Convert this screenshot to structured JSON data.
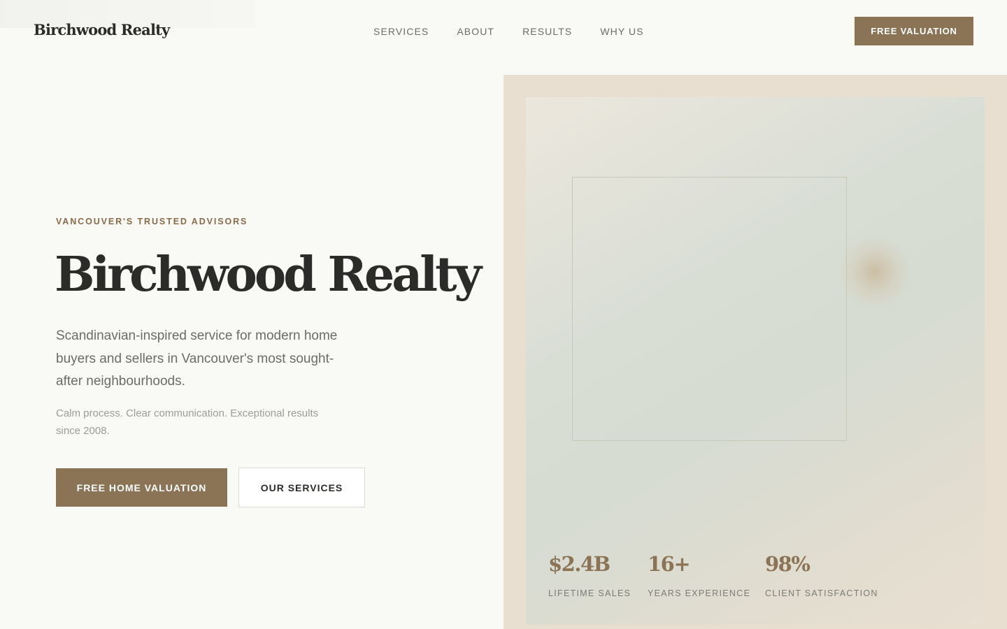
{
  "nav": {
    "logo": "Birchwood Realty",
    "links": [
      "SERVICES",
      "ABOUT",
      "RESULTS",
      "WHY US"
    ],
    "cta": "FREE VALUATION"
  },
  "hero": {
    "eyebrow": "VANCOUVER'S TRUSTED ADVISORS",
    "title": "Birchwood Realty",
    "subtitle": "Scandinavian-inspired service for modern home buyers and sellers in Vancouver's most sought-after neighbourhoods.",
    "note": "Calm process. Clear communication. Exceptional results since 2008.",
    "primary_button": "FREE HOME VALUATION",
    "secondary_button": "OUR SERVICES"
  },
  "stats": [
    {
      "value": "$2.4B",
      "label": "LIFETIME SALES"
    },
    {
      "value": "16+",
      "label": "YEARS EXPERIENCE"
    },
    {
      "value": "98%",
      "label": "CLIENT SATISFACTION"
    }
  ],
  "colors": {
    "accent": "#8b7355",
    "background": "#f9f9f6",
    "panel": "#e8dfd1",
    "text": "#2b2b29"
  }
}
